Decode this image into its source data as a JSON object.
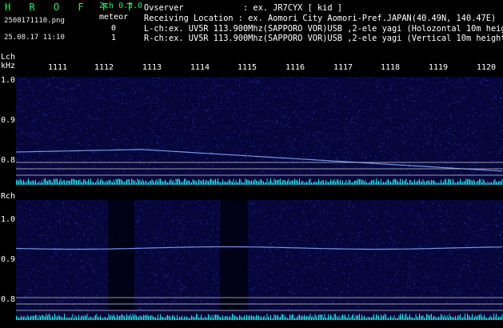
{
  "header": {
    "title": "H R O F F T",
    "filename": "2508171110.png",
    "datetime": "25.08.17 11:10",
    "mode": "2ch 0.3.0",
    "meteor_label": "meteor",
    "lch_count": "0",
    "rch_count": "1",
    "observer": "Ovserver            : ex. JR7CYX [ kid ]",
    "location": "Receiving Location : ex. Aomori City Aomori-Pref.JAPAN(40.49N, 140.47E)",
    "lch_info": "L-ch:ex. UV5R 113.900Mhz(SAPPORO VOR)USB ,2-ele yagi (Holozontal 10m height",
    "rch_info": "R-ch:ex. UV5R 113.900Mhz(SAPPORO VOR)USB ,2-ele yagi (Vertical 10m height)"
  },
  "axis": {
    "lch_label": "Lch",
    "unit_label": "kHz",
    "rch_label": "Rch",
    "time_ticks": [
      "1111",
      "1112",
      "1113",
      "1114",
      "1115",
      "1116",
      "1117",
      "1118",
      "1119",
      "1120"
    ],
    "lch_freq_ticks": [
      "1.0",
      "0.9",
      "0.8"
    ],
    "rch_freq_ticks": [
      "1.0",
      "0.9",
      "0.8"
    ]
  },
  "colors": {
    "panel_bg": "#06063a",
    "noise": "#2a3cc8",
    "signal_trace": "#7aa8ff",
    "level_bars": "#22dddd",
    "header_green": "#22ee66"
  }
}
